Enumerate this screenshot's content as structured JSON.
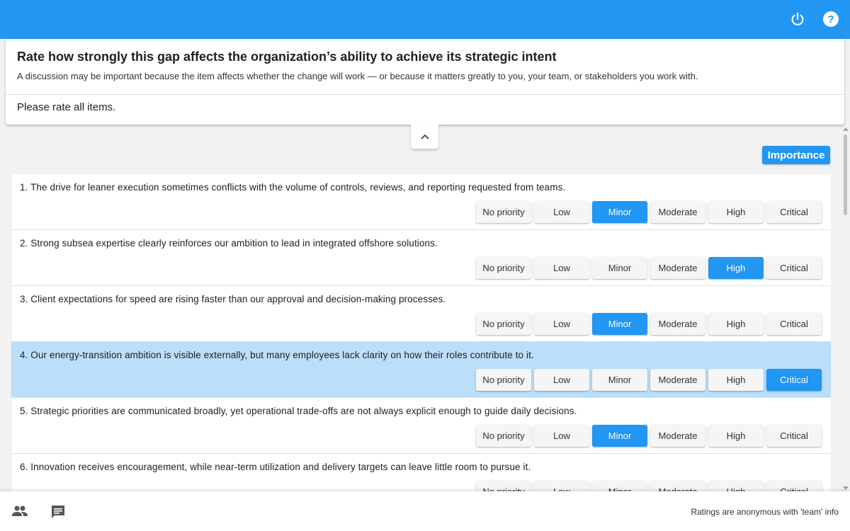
{
  "topbar": {
    "color": "#2196f3",
    "icons": [
      "power-icon",
      "help-icon"
    ]
  },
  "header": {
    "title": "Rate how strongly this gap affects the organization’s ability to achieve its strategic intent",
    "subtitle": "A discussion may be important because the item affects whether the change will work — or because it matters greatly to you, your team, or stakeholders you work with.",
    "instruction": "Please rate all items."
  },
  "importance_label": "Importance",
  "options": [
    "No priority",
    "Low",
    "Minor",
    "Moderate",
    "High",
    "Critical"
  ],
  "items": [
    {
      "text": "1. The drive for leaner execution sometimes conflicts with the volume of controls, reviews, and reporting requested from teams.",
      "selected": "Minor",
      "highlighted": false
    },
    {
      "text": "2. Strong subsea expertise clearly reinforces our ambition to lead in integrated offshore solutions.",
      "selected": "High",
      "highlighted": false
    },
    {
      "text": "3. Client expectations for speed are rising faster than our approval and decision-making processes.",
      "selected": "Minor",
      "highlighted": false
    },
    {
      "text": "4. Our energy-transition ambition is visible externally, but many employees lack clarity on how their roles contribute to it.",
      "selected": "Critical",
      "highlighted": true
    },
    {
      "text": "5. Strategic priorities are communicated broadly, yet operational trade-offs are not always explicit enough to guide daily decisions.",
      "selected": "Minor",
      "highlighted": false
    },
    {
      "text": "6. Innovation receives encouragement, while near-term utilization and delivery targets can leave little room to pursue it.",
      "selected": null,
      "highlighted": false
    }
  ],
  "footer": {
    "info": "Ratings are anonymous with 'team' info",
    "icons": [
      "people-icon",
      "chat-icon"
    ]
  },
  "colors": {
    "accent": "#2196f3",
    "highlight_row": "#bbdefb"
  }
}
